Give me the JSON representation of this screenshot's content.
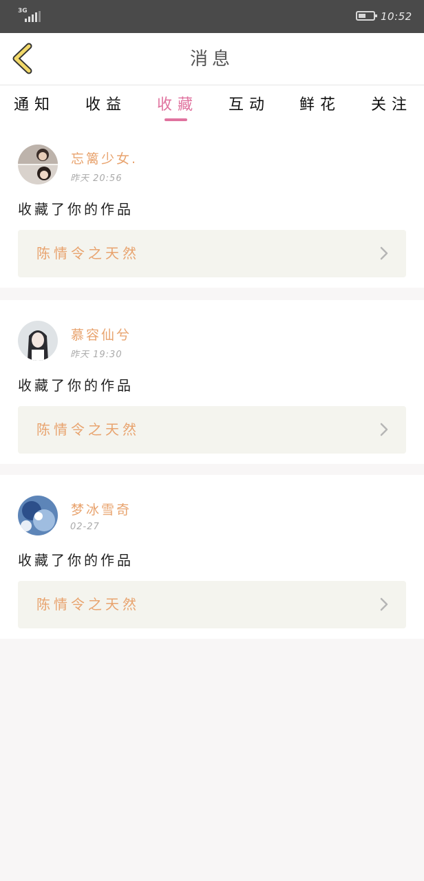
{
  "status_bar": {
    "network": "3G",
    "time": "10:52"
  },
  "header": {
    "title": "消息"
  },
  "tabs": [
    {
      "label": "通知",
      "active": false
    },
    {
      "label": "收益",
      "active": false
    },
    {
      "label": "收藏",
      "active": true
    },
    {
      "label": "互动",
      "active": false
    },
    {
      "label": "鲜花",
      "active": false
    },
    {
      "label": "关注",
      "active": false
    }
  ],
  "messages": [
    {
      "username": "忘篱少女.",
      "time": "昨天 20:56",
      "text": "收藏了你的作品",
      "work_title": "陈情令之天然"
    },
    {
      "username": "慕容仙兮",
      "time": "昨天 19:30",
      "text": "收藏了你的作品",
      "work_title": "陈情令之天然"
    },
    {
      "username": "梦冰雪奇",
      "time": "02-27",
      "text": "收藏了你的作品",
      "work_title": "陈情令之天然"
    }
  ],
  "colors": {
    "accent_pink": "#e0739f",
    "username_orange": "#e8a36e",
    "back_arrow_yellow": "#f2d96a",
    "status_bar_bg": "#4a4a4a"
  },
  "icons": {
    "back": "chevron-left-icon",
    "card_arrow": "chevron-right-icon",
    "signal": "signal-icon",
    "battery": "battery-icon"
  }
}
